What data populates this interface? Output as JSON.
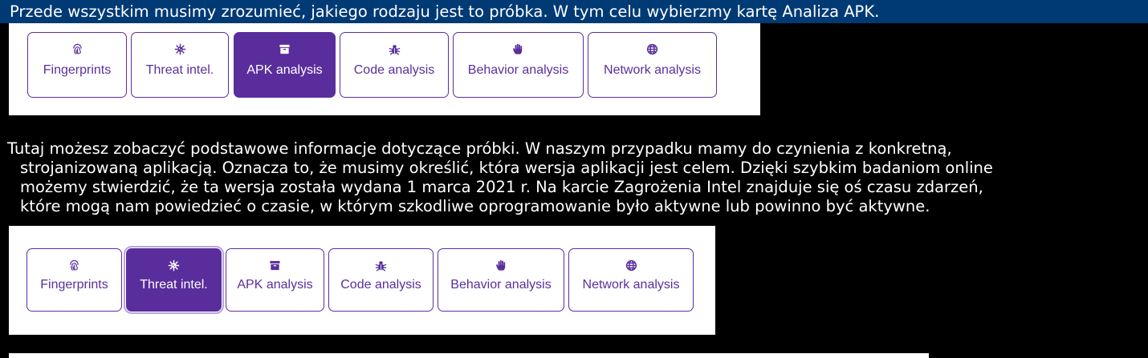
{
  "heading": "Przede wszystkim musimy zrozumieć, jakiego rodzaju jest to próbka. W tym celu wybierzmy kartę Analiza APK.",
  "paragraph": {
    "lines": [
      "Tutaj możesz zobaczyć podstawowe informacje dotyczące próbki. W naszym przypadku mamy do czynienia z konkretną,",
      "strojanizowaną aplikacją. Oznacza to, że musimy określić, która wersja aplikacji jest celem.  Dzięki szybkim badaniom online",
      "możemy stwierdzić, że ta wersja została wydana 1 marca 2021 r.  Na karcie Zagrożenia Intel znajduje się oś czasu zdarzeń,",
      "które mogą nam powiedzieć o czasie, w którym szkodliwe oprogramowanie było aktywne lub powinno być aktywne."
    ]
  },
  "tabs_top": {
    "active": "APK analysis",
    "items": [
      {
        "label": "Fingerprints",
        "icon": "fingerprint-icon"
      },
      {
        "label": "Threat intel.",
        "icon": "virus-icon"
      },
      {
        "label": "APK analysis",
        "icon": "archive-icon"
      },
      {
        "label": "Code analysis",
        "icon": "bug-icon"
      },
      {
        "label": "Behavior analysis",
        "icon": "hand-icon"
      },
      {
        "label": "Network analysis",
        "icon": "globe-icon"
      }
    ]
  },
  "tabs_bottom": {
    "active": "Threat intel.",
    "items": [
      {
        "label": "Fingerprints",
        "icon": "fingerprint-icon"
      },
      {
        "label": "Threat intel.",
        "icon": "virus-icon"
      },
      {
        "label": "APK analysis",
        "icon": "archive-icon"
      },
      {
        "label": "Code analysis",
        "icon": "bug-icon"
      },
      {
        "label": "Behavior analysis",
        "icon": "hand-icon"
      },
      {
        "label": "Network analysis",
        "icon": "globe-icon"
      }
    ]
  },
  "colors": {
    "title_bar": "#003a75",
    "accent": "#5a2d9c",
    "background": "#000000",
    "text": "#ffffff"
  }
}
